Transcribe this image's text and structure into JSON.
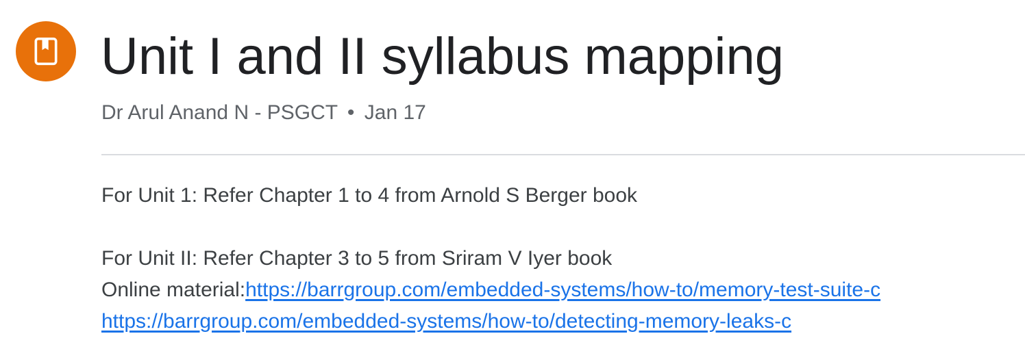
{
  "post": {
    "title": "Unit I and II syllabus mapping",
    "author": "Dr Arul Anand N - PSGCT",
    "separator": "•",
    "date": "Jan 17",
    "icon": "bookmark-icon",
    "accent_color": "#e8710a"
  },
  "content": {
    "line1": "For Unit 1: Refer Chapter 1 to 4 from Arnold S Berger book",
    "line2": "For Unit II: Refer Chapter 3 to 5 from Sriram V Iyer book",
    "line3_prefix": "Online material:",
    "link1": "https://barrgroup.com/embedded-systems/how-to/memory-test-suite-c",
    "link2": "https://barrgroup.com/embedded-systems/how-to/detecting-memory-leaks-c"
  }
}
